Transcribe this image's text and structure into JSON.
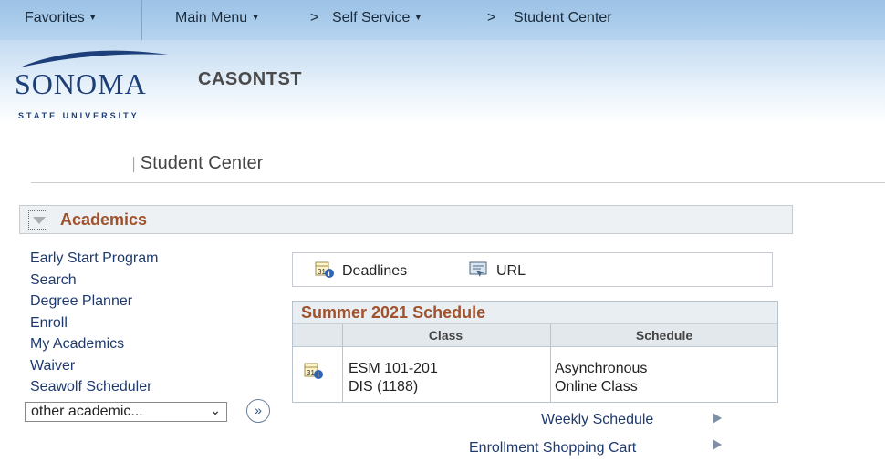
{
  "topnav": {
    "favorites": "Favorites",
    "main_menu": "Main Menu",
    "crumb_self_service": "Self Service",
    "crumb_student_center": "Student Center",
    "crumb_sep": ">"
  },
  "header": {
    "logo_word": "SONOMA",
    "logo_sub": "STATE UNIVERSITY",
    "database": "CASONTST"
  },
  "page": {
    "title": "Student Center",
    "title_prefix": "│"
  },
  "academics": {
    "section_title": "Academics",
    "links": [
      "Early Start Program",
      "Search",
      "Degree Planner",
      "Enroll",
      "My Academics",
      "Waiver",
      "Seawolf Scheduler"
    ],
    "other_select": "other academic...",
    "toolbar": {
      "deadlines": "Deadlines",
      "url": "URL"
    },
    "schedule": {
      "title": "Summer 2021 Schedule",
      "columns": [
        "Class",
        "Schedule"
      ],
      "rows": [
        {
          "class_line1": "ESM 101-201",
          "class_line2": "DIS (1188)",
          "sched_line1": "Asynchronous",
          "sched_line2": "Online Class"
        }
      ]
    },
    "footer_links": {
      "weekly": "Weekly Schedule",
      "cart": "Enrollment Shopping Cart"
    }
  },
  "colors": {
    "nav_bg": "#a9cbeb",
    "section_title": "#a0522d",
    "link": "#1f3a6e",
    "logo": "#1c3f7a"
  }
}
